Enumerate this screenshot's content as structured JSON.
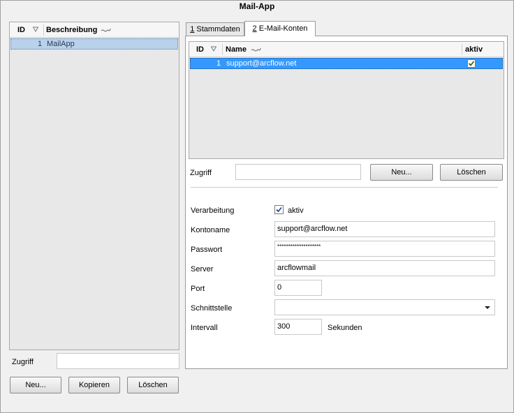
{
  "window": {
    "title": "Mail-App"
  },
  "left_list": {
    "headers": {
      "id": "ID",
      "description": "Beschreibung"
    },
    "rows": [
      {
        "id": "1",
        "description": "MailApp"
      }
    ]
  },
  "left_bottom": {
    "access_label": "Zugriff",
    "access_value": "",
    "new_button": "Neu...",
    "copy_button": "Kopieren",
    "delete_button": "Löschen"
  },
  "tabs": [
    {
      "accel": "1",
      "label": " Stammdaten"
    },
    {
      "accel": "2",
      "label": " E-Mail-Konten"
    }
  ],
  "accounts_list": {
    "headers": {
      "id": "ID",
      "name": "Name",
      "active": "aktiv"
    },
    "rows": [
      {
        "id": "1",
        "name": "support@arcflow.net",
        "active": true
      }
    ]
  },
  "right_access": {
    "label": "Zugriff",
    "value": "",
    "new_button": "Neu...",
    "delete_button": "Löschen"
  },
  "form": {
    "processing_label": "Verarbeitung",
    "processing_checkbox_label": "aktiv",
    "processing_checked": true,
    "account_name_label": "Kontoname",
    "account_name_value": "support@arcflow.net",
    "password_label": "Passwort",
    "password_value": "********************",
    "server_label": "Server",
    "server_value": "arcflowmail",
    "port_label": "Port",
    "port_value": "0",
    "interface_label": "Schnittstelle",
    "interface_value": "",
    "interval_label": "Intervall",
    "interval_value": "300",
    "interval_unit": "Sekunden"
  },
  "icons": {
    "sort": "sort-triangle-icon",
    "column_options": "wave-icon",
    "checkbox": "checkmark-icon",
    "dropdown": "chevron-down-icon"
  },
  "colors": {
    "selection_blue": "#3399ff",
    "selection_light": "#b9d1ea",
    "window_bg": "#f0f0f0"
  }
}
